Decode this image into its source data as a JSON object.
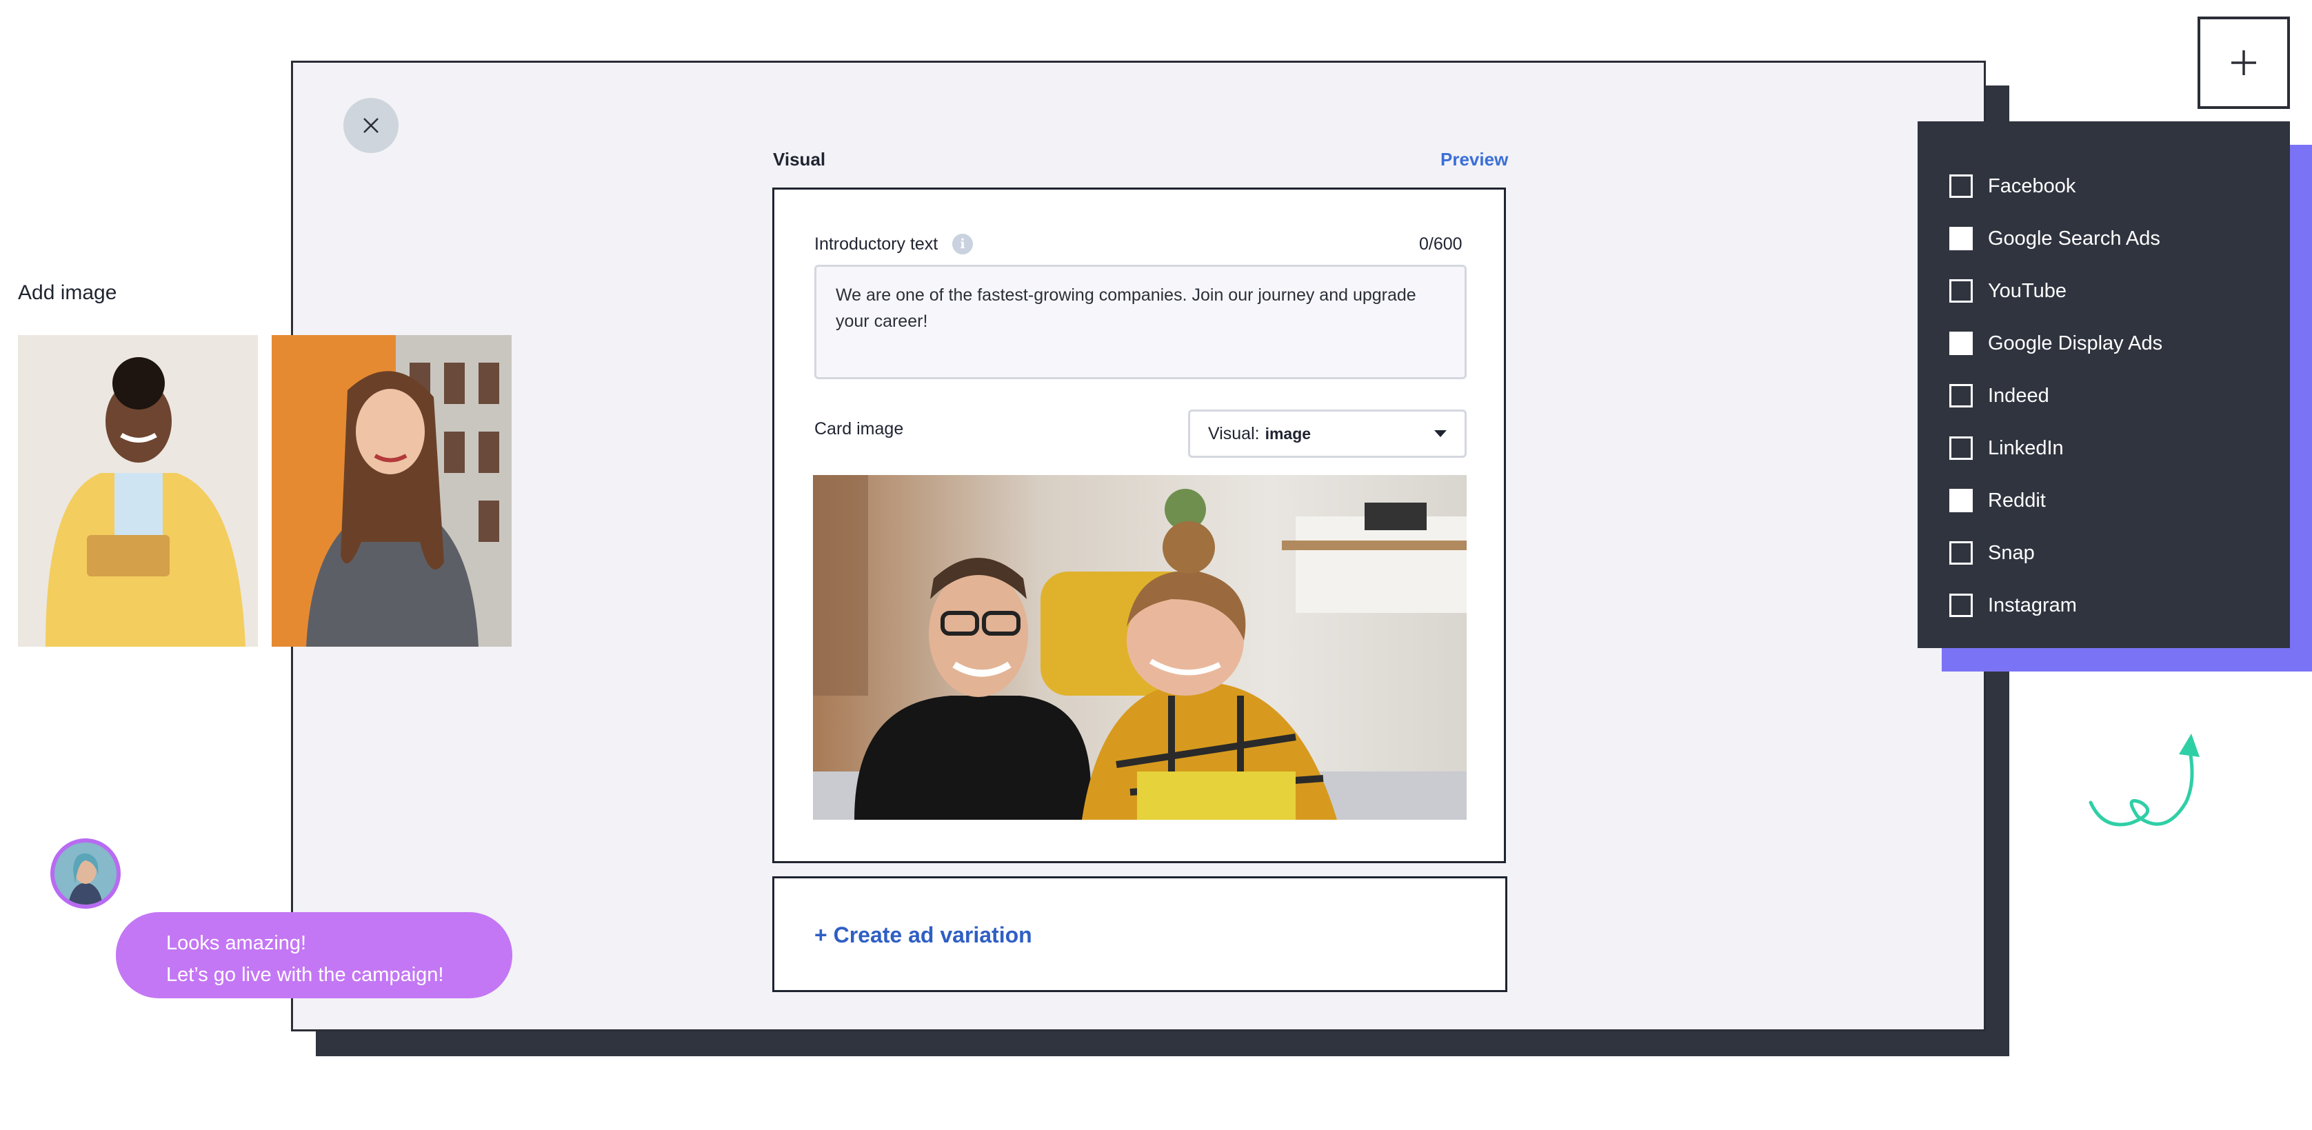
{
  "editor": {
    "visual_label": "Visual",
    "preview_label": "Preview",
    "intro_label": "Introductory text",
    "intro_info_icon": "info-icon",
    "counter": "0/600",
    "intro_text": "We are one of the fastest-growing companies. Join our journey and upgrade your career!",
    "card_image_label": "Card image",
    "dropdown_prefix": "Visual:",
    "dropdown_value": "image",
    "create_variation_label": "+ Create ad variation"
  },
  "left": {
    "add_image_label": "Add image",
    "chat": {
      "line1": "Looks amazing!",
      "line2": "Let’s go live with the campaign!"
    }
  },
  "channels": {
    "items": [
      {
        "label": "Facebook",
        "checked": false
      },
      {
        "label": "Google Search Ads",
        "checked": true
      },
      {
        "label": "YouTube",
        "checked": false
      },
      {
        "label": "Google Display Ads",
        "checked": true
      },
      {
        "label": "Indeed",
        "checked": false
      },
      {
        "label": "LinkedIn",
        "checked": false
      },
      {
        "label": "Reddit",
        "checked": true
      },
      {
        "label": "Snap",
        "checked": false
      },
      {
        "label": "Instagram",
        "checked": false
      }
    ]
  },
  "colors": {
    "window_bg": "#f2f2f7",
    "dark": "#30343f",
    "accent_blue": "#3b6fd6",
    "panel_shadow": "#7b73f5",
    "chat_purple": "#c477f4",
    "swirl": "#2fcfa6"
  }
}
